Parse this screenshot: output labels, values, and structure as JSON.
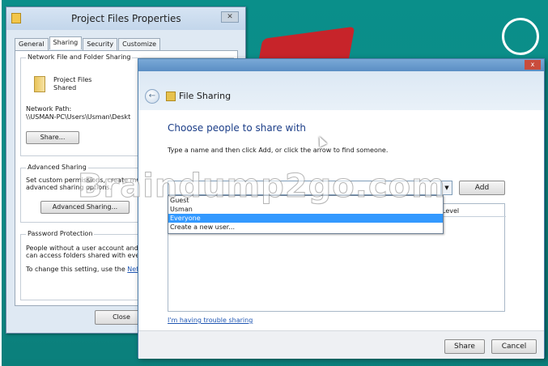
{
  "props_window": {
    "title": "Project Files Properties",
    "close_glyph": "✕",
    "tabs": [
      "General",
      "Sharing",
      "Security",
      "Customize"
    ],
    "network_group": "Network File and Folder Sharing",
    "folder_name": "Project Files",
    "folder_status": "Shared",
    "network_path_label": "Network Path:",
    "network_path": "\\\\USMAN-PC\\Users\\Usman\\Deskt",
    "share_button": "Share...",
    "advanced_group": "Advanced Sharing",
    "advanced_text_1": "Set custom permissions, create mult",
    "advanced_text_2": "advanced sharing options.",
    "advanced_button": "Advanced Sharing...",
    "password_group": "Password Protection",
    "password_text_1": "People without a user account and",
    "password_text_2": "can access folders shared with eve",
    "password_text_3": "To change this setting, use the",
    "password_link": "Net",
    "close_button": "Close"
  },
  "file_sharing": {
    "title": "File Sharing",
    "close_glyph": "x",
    "back_glyph": "←",
    "heading": "Choose people to share with",
    "instructions": "Type a name and then click Add, or click the arrow to find someone.",
    "input_value": "",
    "dropdown_arrow": "▼",
    "add_button": "Add",
    "level_header": "Level",
    "dropdown_items": [
      "Guest",
      "Usman",
      "Everyone",
      "Create a new user..."
    ],
    "selected_item": "Everyone",
    "trouble_link": "I'm having trouble sharing",
    "share_button": "Share",
    "cancel_button": "Cancel"
  },
  "watermark": "Braindump2go.com"
}
